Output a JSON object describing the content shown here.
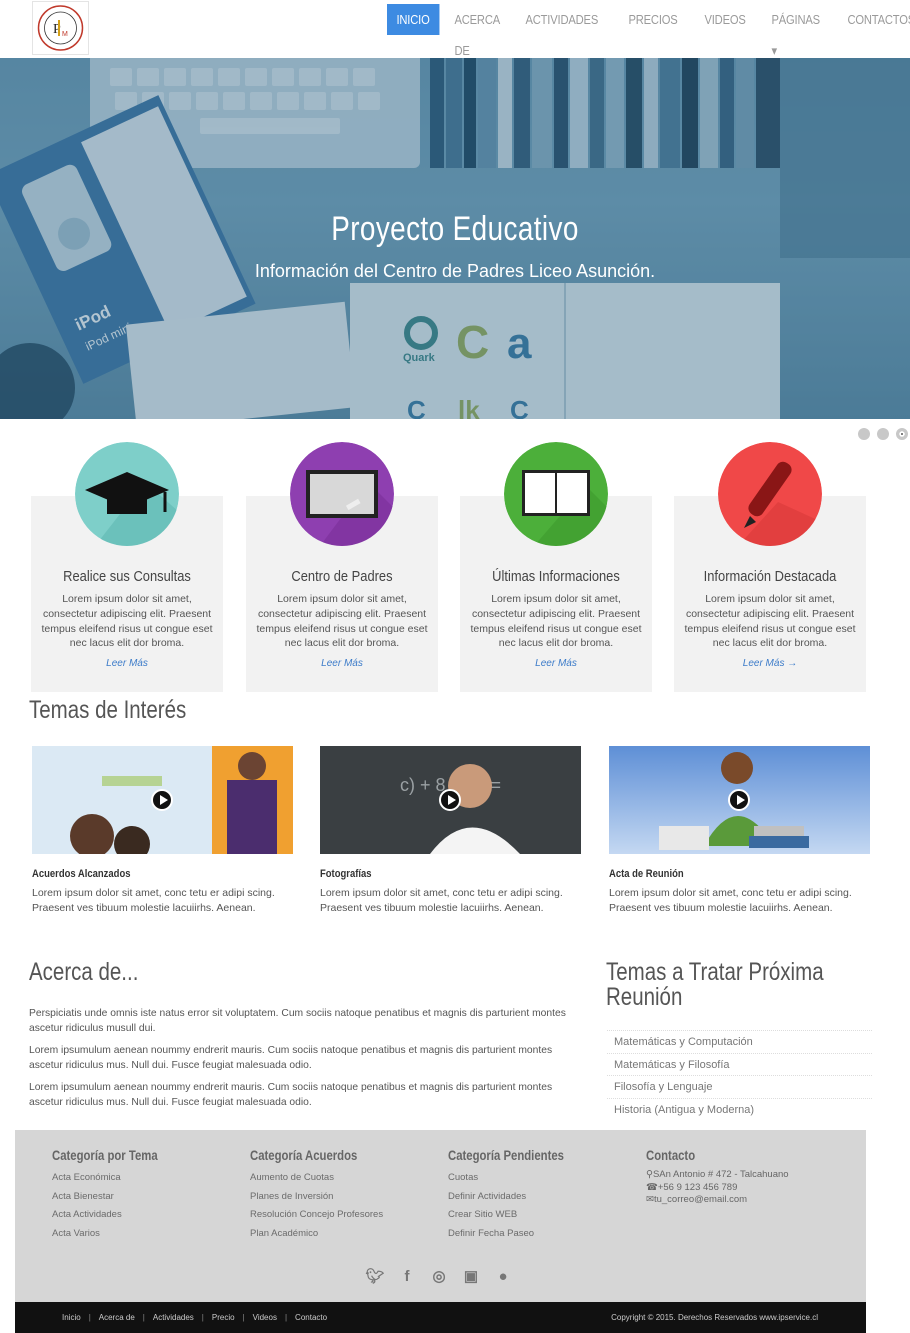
{
  "nav": {
    "items": [
      "Inicio",
      "Acerca de",
      "Actividades",
      "Precios",
      "Videos",
      "Páginas ▾",
      "Contactos"
    ],
    "active_index": 0,
    "accent": "#3d8be2"
  },
  "hero": {
    "title": "Proyecto Educativo",
    "subtitle": "Información del Centro de Padres Liceo Asunción.",
    "slides": 3,
    "active_slide": 3
  },
  "features": [
    {
      "title": "Realice sus Consultas",
      "text": "Lorem ipsum dolor sit amet, consectetur adipiscing elit. Praesent tempus eleifend risus ut congue eset nec lacus elit dor broma.",
      "link": "Leer Más",
      "icon": "graduation-cap-icon",
      "color": "#7ecfc9"
    },
    {
      "title": "Centro de Padres",
      "text": "Lorem ipsum dolor sit amet, consectetur adipiscing elit. Praesent tempus eleifend risus ut congue eset nec lacus elit dor broma.",
      "link": "Leer Más",
      "icon": "whiteboard-icon",
      "color": "#8e3fb0"
    },
    {
      "title": "Últimas Informaciones",
      "text": "Lorem ipsum dolor sit amet, consectetur adipiscing elit. Praesent tempus eleifend risus ut congue eset nec lacus elit dor broma.",
      "link": "Leer Más",
      "icon": "open-book-icon",
      "color": "#4caf3a"
    },
    {
      "title": "Información Destacada",
      "text": "Lorem ipsum dolor sit amet, consectetur adipiscing elit. Praesent tempus eleifend risus ut congue eset nec lacus elit dor broma.",
      "link": "Leer Más →",
      "icon": "pen-icon",
      "color": "#f04848"
    }
  ],
  "temas": {
    "title": "Temas de Interés",
    "videos": [
      {
        "title": "Acuerdos Alcanzados",
        "text": "Lorem ipsum dolor sit amet, conc tetu er adipi scing. Praesent ves tibuum molestie lacuiirhs. Aenean."
      },
      {
        "title": "Fotografías",
        "text": "Lorem ipsum dolor sit amet, conc tetu er adipi scing. Praesent ves tibuum molestie lacuiirhs. Aenean."
      },
      {
        "title": "Acta de Reunión",
        "text": "Lorem ipsum dolor sit amet, conc tetu er adipi scing. Praesent ves tibuum molestie lacuiirhs. Aenean."
      }
    ]
  },
  "about": {
    "title": "Acerca de...",
    "paragraphs": [
      "Perspiciatis unde omnis iste natus error sit voluptatem. Cum sociis natoque penatibus et magnis dis parturient montes ascetur ridiculus musull dui.",
      "Lorem ipsumulum aenean noummy endrerit mauris. Cum sociis natoque penatibus et magnis dis parturient montes ascetur ridiculus mus. Null dui. Fusce feugiat malesuada odio.",
      "Lorem ipsumulum aenean noummy endrerit mauris. Cum sociis natoque penatibus et magnis dis parturient montes ascetur ridiculus mus. Null dui. Fusce feugiat malesuada odio."
    ]
  },
  "topics": {
    "title_line1": "Temas a Tratar Próxima",
    "title_line2": "Reunión",
    "items": [
      "Matemáticas y Computación",
      "Matemáticas y Filosofía",
      "Filosofía y Lenguaje",
      "Historia (Antigua y Moderna)"
    ]
  },
  "footer": {
    "columns": [
      {
        "title": "Categoría por Tema",
        "items": [
          "Acta Económica",
          "Acta Bienestar",
          "Acta Actividades",
          "Acta Varios"
        ]
      },
      {
        "title": "Categoría Acuerdos",
        "items": [
          "Aumento de Cuotas",
          "Planes de Inversión",
          "Resolución Concejo Profesores",
          "Plan Académico"
        ]
      },
      {
        "title": "Categoría Pendientes",
        "items": [
          "Cuotas",
          "Definir Actividades",
          "Crear Sitio WEB",
          "Definir Fecha Paseo"
        ]
      }
    ],
    "contact": {
      "title": "Contacto",
      "address": "SAn Antonio # 472 - Talcahuano",
      "phone": "+56 9 123 456 789",
      "email": "tu_correo@email.com"
    },
    "social": [
      "twitter-icon",
      "facebook-icon",
      "dribbble-icon",
      "flickr-icon",
      "github-icon"
    ]
  },
  "bottom": {
    "links": [
      "Inicio",
      "Acerca de",
      "Actividades",
      "Precio",
      "Videos",
      "Contacto"
    ],
    "copyright": "Copyright © 2015. Derechos Reservados   www.ipservice.cl"
  }
}
